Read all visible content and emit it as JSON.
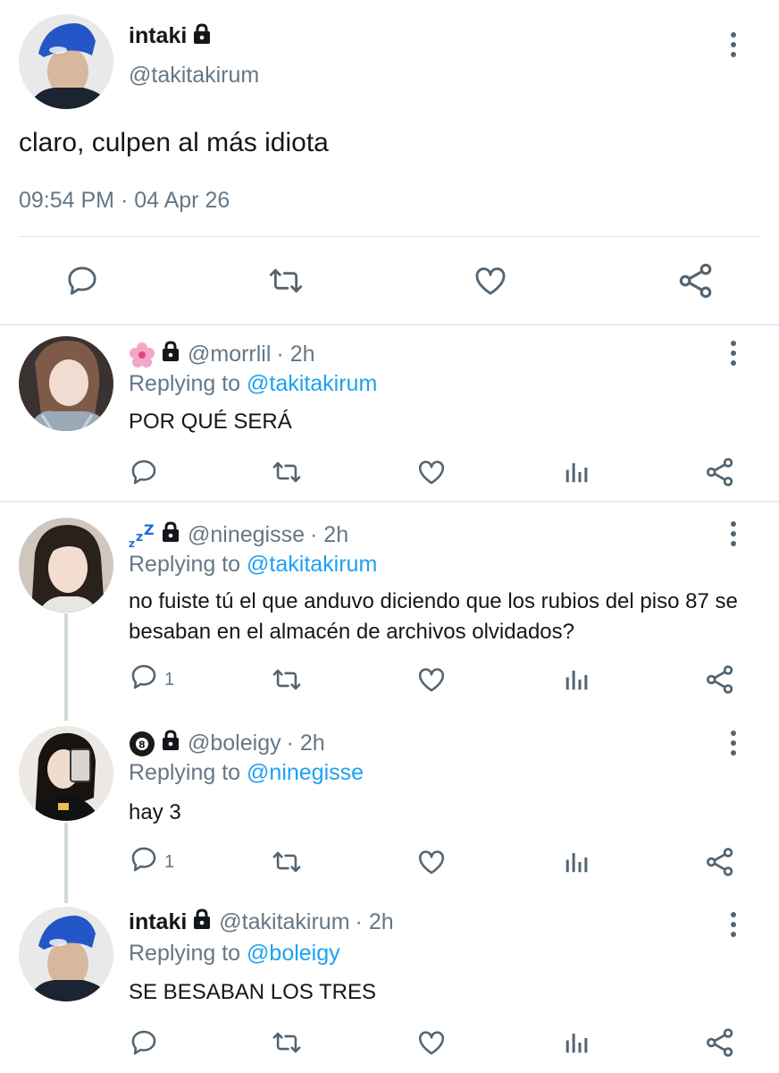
{
  "main_tweet": {
    "display_name": "intaki",
    "handle": "@takitakirum",
    "text": "claro, culpen al más idiota",
    "timestamp": "09:54 PM · 04 Apr 26",
    "actions": [
      "reply-icon",
      "retweet-icon",
      "like-icon",
      "share-icon"
    ]
  },
  "replies": [
    {
      "emoji": "🌸",
      "display_name": "",
      "handle": "@morrlil",
      "age": "· 2h",
      "replying_prefix": "Replying to",
      "replying_to": "@takitakirum",
      "text": "POR QUÉ SERÁ",
      "reply_count": ""
    },
    {
      "emoji": "zzZ",
      "display_name": "",
      "handle": "@ninegisse",
      "age": "· 2h",
      "replying_prefix": "Replying to",
      "replying_to": "@takitakirum",
      "text": "no fuiste tú el que anduvo diciendo que los rubios del piso 87 se besaban en el almacén de archivos olvidados?",
      "reply_count": "1"
    },
    {
      "emoji": "🎱",
      "display_name": "",
      "handle": "@boleigy",
      "age": "· 2h",
      "replying_prefix": "Replying to",
      "replying_to": "@ninegisse",
      "text": "hay 3",
      "reply_count": "1"
    },
    {
      "emoji": "",
      "display_name": "intaki",
      "handle": "@takitakirum",
      "age": "· 2h",
      "replying_prefix": "Replying to",
      "replying_to": "@boleigy",
      "text": "SE BESABAN LOS TRES",
      "reply_count": ""
    }
  ],
  "colors": {
    "link": "#1da1f2",
    "secondary_text": "#657786",
    "icon": "#536471",
    "divider": "#e6ecf0",
    "thread_line": "#cfd9de"
  }
}
